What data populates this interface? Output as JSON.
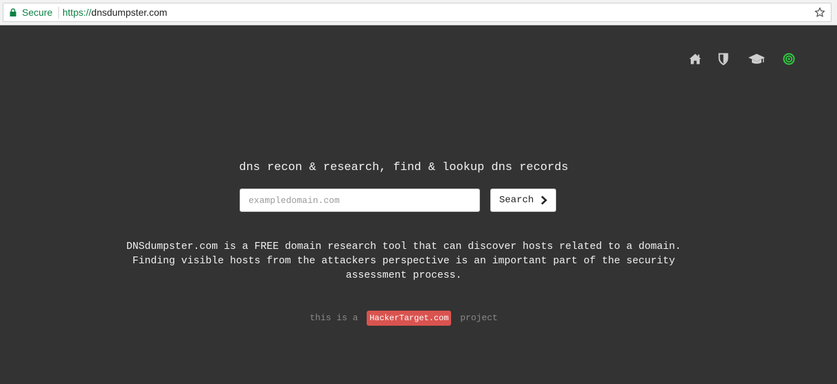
{
  "browser": {
    "secure_label": "Secure",
    "url_scheme": "https://",
    "url_host": "dnsdumpster.com"
  },
  "nav": {
    "icons": [
      "home-icon",
      "shield-icon",
      "graduation-cap-icon",
      "target-icon"
    ],
    "accent_color": "#2ecc40"
  },
  "main": {
    "tagline": "dns recon & research, find & lookup dns records",
    "search": {
      "placeholder": "exampledomain.com",
      "value": "",
      "button_label": "Search"
    },
    "description": "DNSdumpster.com is a FREE domain research tool that can discover hosts related to a domain. Finding visible hosts from the attackers perspective is an important part of the security assessment process."
  },
  "footer": {
    "prefix": "this is a",
    "badge": "HackerTarget.com",
    "suffix": "project",
    "badge_color": "#d9534f"
  }
}
